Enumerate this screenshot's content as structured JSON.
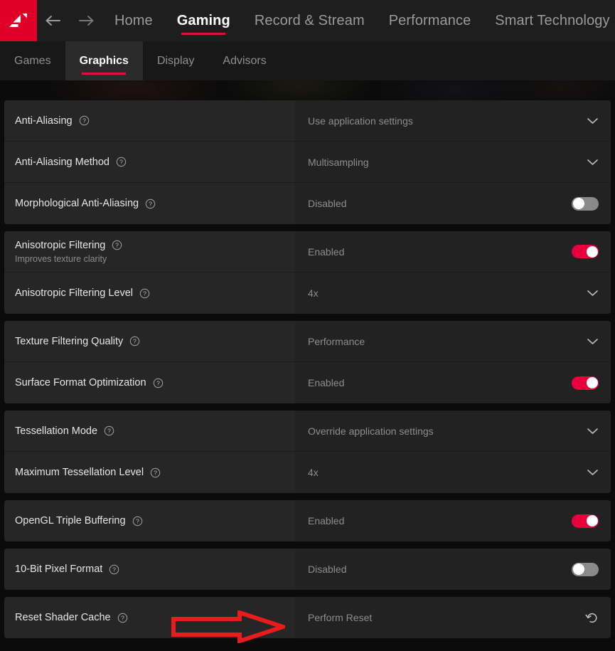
{
  "app": {
    "brand": "AMD",
    "logo_icon": "amd-arrow-logo"
  },
  "topnav": {
    "back_icon": "arrow-left-icon",
    "forward_icon": "arrow-right-icon",
    "items": [
      {
        "label": "Home",
        "active": false
      },
      {
        "label": "Gaming",
        "active": true
      },
      {
        "label": "Record & Stream",
        "active": false
      },
      {
        "label": "Performance",
        "active": false
      },
      {
        "label": "Smart Technology",
        "active": false
      }
    ]
  },
  "subnav": {
    "items": [
      {
        "label": "Games",
        "active": false
      },
      {
        "label": "Graphics",
        "active": true
      },
      {
        "label": "Display",
        "active": false
      },
      {
        "label": "Advisors",
        "active": false
      }
    ]
  },
  "colors": {
    "brand_red": "#e00027",
    "accent_underline": "#d2173b",
    "toggle_on": "#e8003c",
    "toggle_off": "#8a8a8a",
    "annotation_red": "#e81c1c",
    "row_bg": "#262626",
    "row_value_bg": "#222222",
    "page_bg": "#0b0b0b"
  },
  "annotation": {
    "shape": "right-arrow-outline",
    "color": "#e81c1c",
    "points_at": "Perform Reset"
  },
  "settings_groups": [
    {
      "rows": [
        {
          "label": "Anti-Aliasing",
          "sublabel": "",
          "help_icon": "help-circle-icon",
          "value": "Use application settings",
          "control": "dropdown",
          "control_icon": "chevron-down-icon"
        },
        {
          "label": "Anti-Aliasing Method",
          "sublabel": "",
          "help_icon": "help-circle-icon",
          "value": "Multisampling",
          "control": "dropdown",
          "control_icon": "chevron-down-icon"
        },
        {
          "label": "Morphological Anti-Aliasing",
          "sublabel": "",
          "help_icon": "help-circle-icon",
          "value": "Disabled",
          "control": "toggle",
          "toggle_state": "off"
        }
      ]
    },
    {
      "rows": [
        {
          "label": "Anisotropic Filtering",
          "sublabel": "Improves texture clarity",
          "help_icon": "help-circle-icon",
          "value": "Enabled",
          "control": "toggle",
          "toggle_state": "on"
        },
        {
          "label": "Anisotropic Filtering Level",
          "sublabel": "",
          "help_icon": "help-circle-icon",
          "value": "4x",
          "control": "dropdown",
          "control_icon": "chevron-down-icon"
        }
      ]
    },
    {
      "rows": [
        {
          "label": "Texture Filtering Quality",
          "sublabel": "",
          "help_icon": "help-circle-icon",
          "value": "Performance",
          "control": "dropdown",
          "control_icon": "chevron-down-icon"
        },
        {
          "label": "Surface Format Optimization",
          "sublabel": "",
          "help_icon": "help-circle-icon",
          "value": "Enabled",
          "control": "toggle",
          "toggle_state": "on"
        }
      ]
    },
    {
      "rows": [
        {
          "label": "Tessellation Mode",
          "sublabel": "",
          "help_icon": "help-circle-icon",
          "value": "Override application settings",
          "control": "dropdown",
          "control_icon": "chevron-down-icon"
        },
        {
          "label": "Maximum Tessellation Level",
          "sublabel": "",
          "help_icon": "help-circle-icon",
          "value": "4x",
          "control": "dropdown",
          "control_icon": "chevron-down-icon"
        }
      ]
    },
    {
      "rows": [
        {
          "label": "OpenGL Triple Buffering",
          "sublabel": "",
          "help_icon": "help-circle-icon",
          "value": "Enabled",
          "control": "toggle",
          "toggle_state": "on"
        }
      ]
    },
    {
      "rows": [
        {
          "label": "10-Bit Pixel Format",
          "sublabel": "",
          "help_icon": "help-circle-icon",
          "value": "Disabled",
          "control": "toggle",
          "toggle_state": "off"
        }
      ]
    },
    {
      "rows": [
        {
          "label": "Reset Shader Cache",
          "sublabel": "",
          "help_icon": "help-circle-icon",
          "value": "Perform Reset",
          "control": "reset",
          "control_icon": "reset-rotate-icon"
        }
      ]
    }
  ]
}
